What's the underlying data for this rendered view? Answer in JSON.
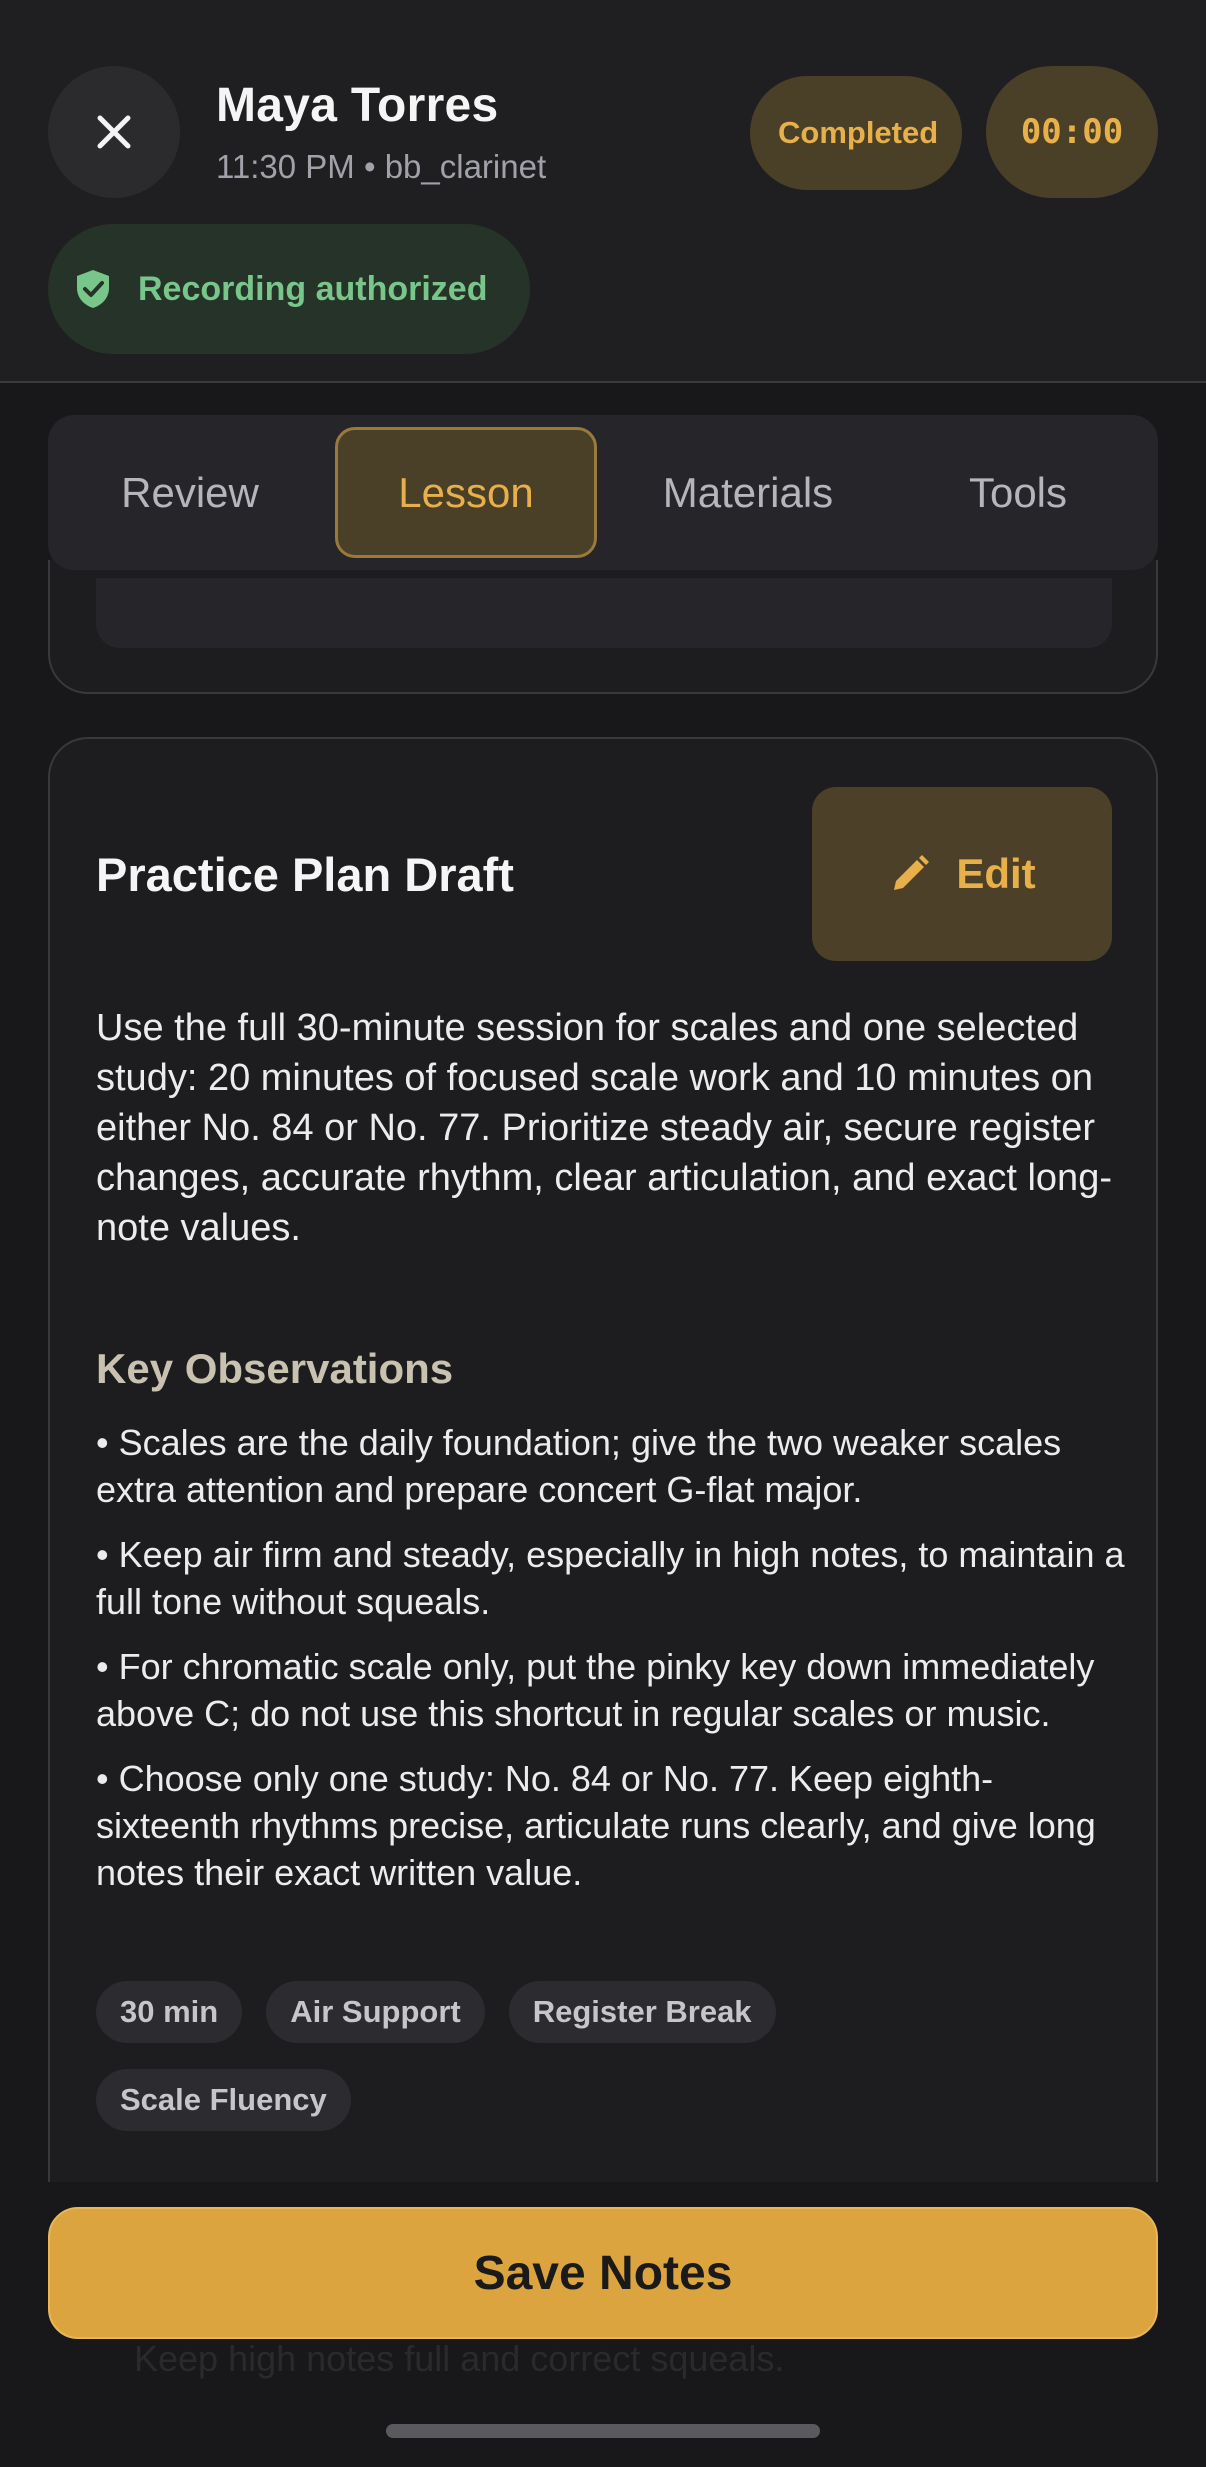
{
  "header": {
    "student_name": "Maya Torres",
    "session_meta": "11:30 PM • bb_clarinet",
    "status": "Completed",
    "timer": "00:00",
    "recording_status": "Recording authorized"
  },
  "tabs": [
    {
      "label": "Review",
      "active": false
    },
    {
      "label": "Lesson",
      "active": true
    },
    {
      "label": "Materials",
      "active": false
    },
    {
      "label": "Tools",
      "active": false
    }
  ],
  "plan": {
    "title": "Practice Plan Draft",
    "edit_label": "Edit",
    "summary": "Use the full 30-minute session for scales and one selected study: 20 minutes of focused scale work and 10 minutes on either No. 84 or No. 77. Prioritize steady air, secure register changes, accurate rhythm, clear articulation, and exact long-note values.",
    "observations_heading": "Key Observations",
    "observations": [
      "• Scales are the daily foundation; give the two weaker scales extra attention and prepare concert G-flat major.",
      "• Keep air firm and steady, especially in high notes, to maintain a full tone without squeals.",
      "• For chromatic scale only, put the pinky key down immediately above C; do not use this shortcut in regular scales or music.",
      "• Choose only one study: No. 84 or No. 77. Keep eighth-sixteenth rhythms precise, articulate runs clearly, and give long notes their exact written value."
    ],
    "tags": [
      "30 min",
      "Air Support",
      "Register Break",
      "Scale Fluency"
    ]
  },
  "footer": {
    "save_label": "Save Notes",
    "ghost_text": "Practice scales with firm, steady air through the register. Keep high notes full and correct squeals."
  },
  "colors": {
    "accent": "#e8b04a",
    "accent_button": "#dba43f",
    "success": "#79c68a",
    "background": "#18181b"
  }
}
